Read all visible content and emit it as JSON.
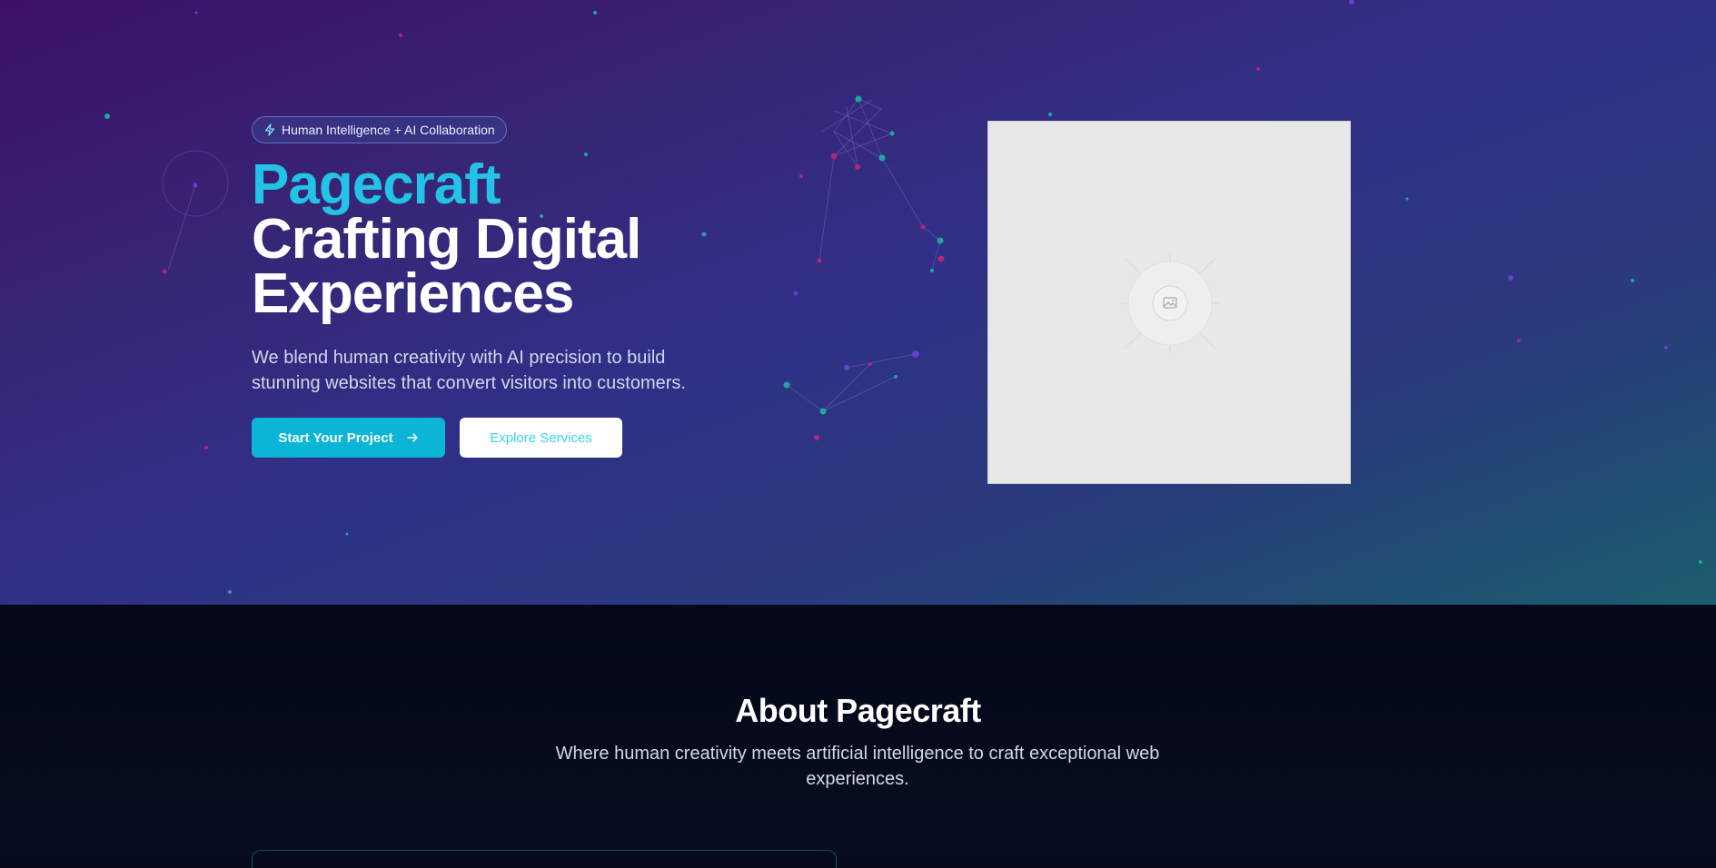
{
  "hero": {
    "badge": {
      "icon": "lightning-bolt-icon",
      "label": "Human Intelligence + AI Collaboration"
    },
    "title_accent": "Pagecraft",
    "title_line1": "Crafting Digital",
    "title_line2": "Experiences",
    "subtitle": "We blend human creativity with AI precision to build stunning websites that convert visitors into customers.",
    "primary_button": {
      "label": "Start Your Project",
      "icon": "arrow-right-icon"
    },
    "secondary_button": {
      "label": "Explore Services"
    },
    "image": {
      "icon": "image-placeholder-icon"
    }
  },
  "about": {
    "title": "About Pagecraft",
    "description": "Where human creativity meets artificial intelligence to craft exceptional web experiences."
  },
  "colors": {
    "accent": "#22c3e6",
    "primary_button": "#0ab5d6",
    "hero_gradient_start": "#3d0f68",
    "hero_gradient_end": "#1d5d6e",
    "about_background": "#050a1b"
  }
}
